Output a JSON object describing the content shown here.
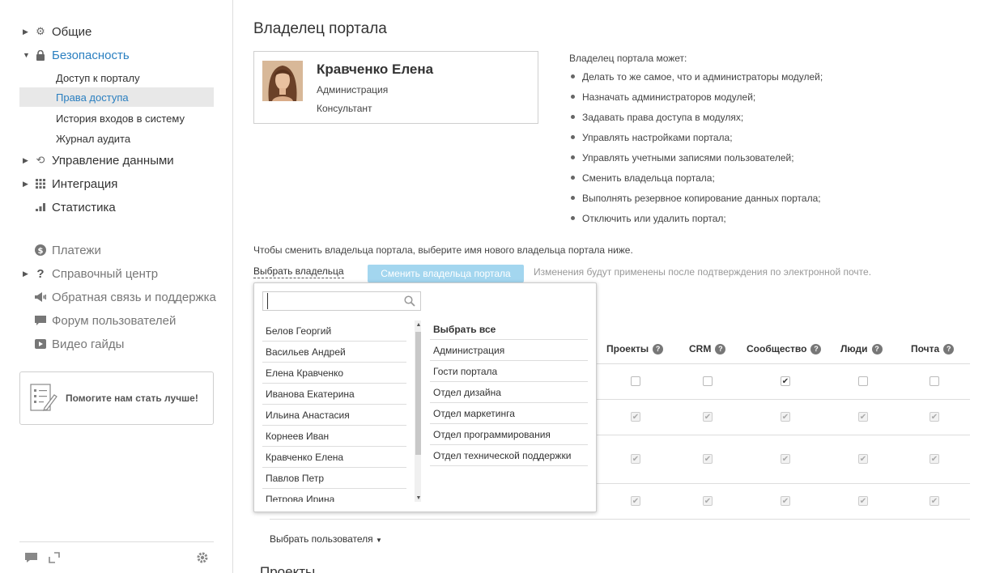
{
  "sidebar": {
    "items": [
      {
        "label": "Общие"
      },
      {
        "label": "Безопасность"
      },
      {
        "label": "Управление данными"
      },
      {
        "label": "Интеграция"
      },
      {
        "label": "Статистика"
      },
      {
        "label": "Платежи"
      },
      {
        "label": "Справочный центр"
      },
      {
        "label": "Обратная связь и поддержка"
      },
      {
        "label": "Форум пользователей"
      },
      {
        "label": "Видео гайды"
      }
    ],
    "security_sub": [
      {
        "label": "Доступ к порталу"
      },
      {
        "label": "Права доступа"
      },
      {
        "label": "История входов в систему"
      },
      {
        "label": "Журнал аудита"
      }
    ],
    "help_label": "Помогите нам стать лучше!"
  },
  "main": {
    "title": "Владелец портала",
    "owner": {
      "name": "Кравченко Елена",
      "department": "Администрация",
      "position": "Консультант"
    },
    "can_title": "Владелец портала может:",
    "can_list": [
      "Делать то же самое, что и администраторы модулей;",
      "Назначать администраторов модулей;",
      "Задавать права доступа в модулях;",
      "Управлять настройками портала;",
      "Управлять учетными записями пользователей;",
      "Сменить владельца портала;",
      "Выполнять резервное копирование данных портала;",
      "Отключить или удалить портал;"
    ],
    "instruction": "Чтобы сменить владельца портала, выберите имя нового владельца портала ниже.",
    "choose_owner": "Выбрать владельца",
    "change_button": "Сменить владельца портала",
    "change_note": "Изменения будут применены после подтверждения по электронной почте.",
    "table_headers": [
      "Проекты",
      "CRM",
      "Сообщество",
      "Люди",
      "Почта"
    ],
    "choose_user": "Выбрать пользователя",
    "projects_title": "Проекты"
  },
  "popup": {
    "search_value": "",
    "users": [
      "Белов Георгий",
      "Васильев Андрей",
      "Елена Кравченко",
      "Иванова Екатерина",
      "Ильина Анастасия",
      "Корнеев Иван",
      "Кравченко Елена",
      "Павлов Петр",
      "Петрова Ирина"
    ],
    "groups": [
      "Выбрать все",
      "Администрация",
      "Гости портала",
      "Отдел дизайна",
      "Отдел маркетинга",
      "Отдел программирования",
      "Отдел технической поддержки"
    ]
  },
  "colors": {
    "accent": "#2a7fc0",
    "button": "#a3d6ef"
  },
  "icons": [
    "gear-icon",
    "lock-icon",
    "refresh-icon",
    "grid-icon",
    "bar-chart-icon",
    "dollar-icon",
    "question-icon",
    "megaphone-icon",
    "chat-icon",
    "video-icon",
    "search-icon",
    "chat-footer-icon",
    "expand-icon",
    "settings-icon"
  ]
}
